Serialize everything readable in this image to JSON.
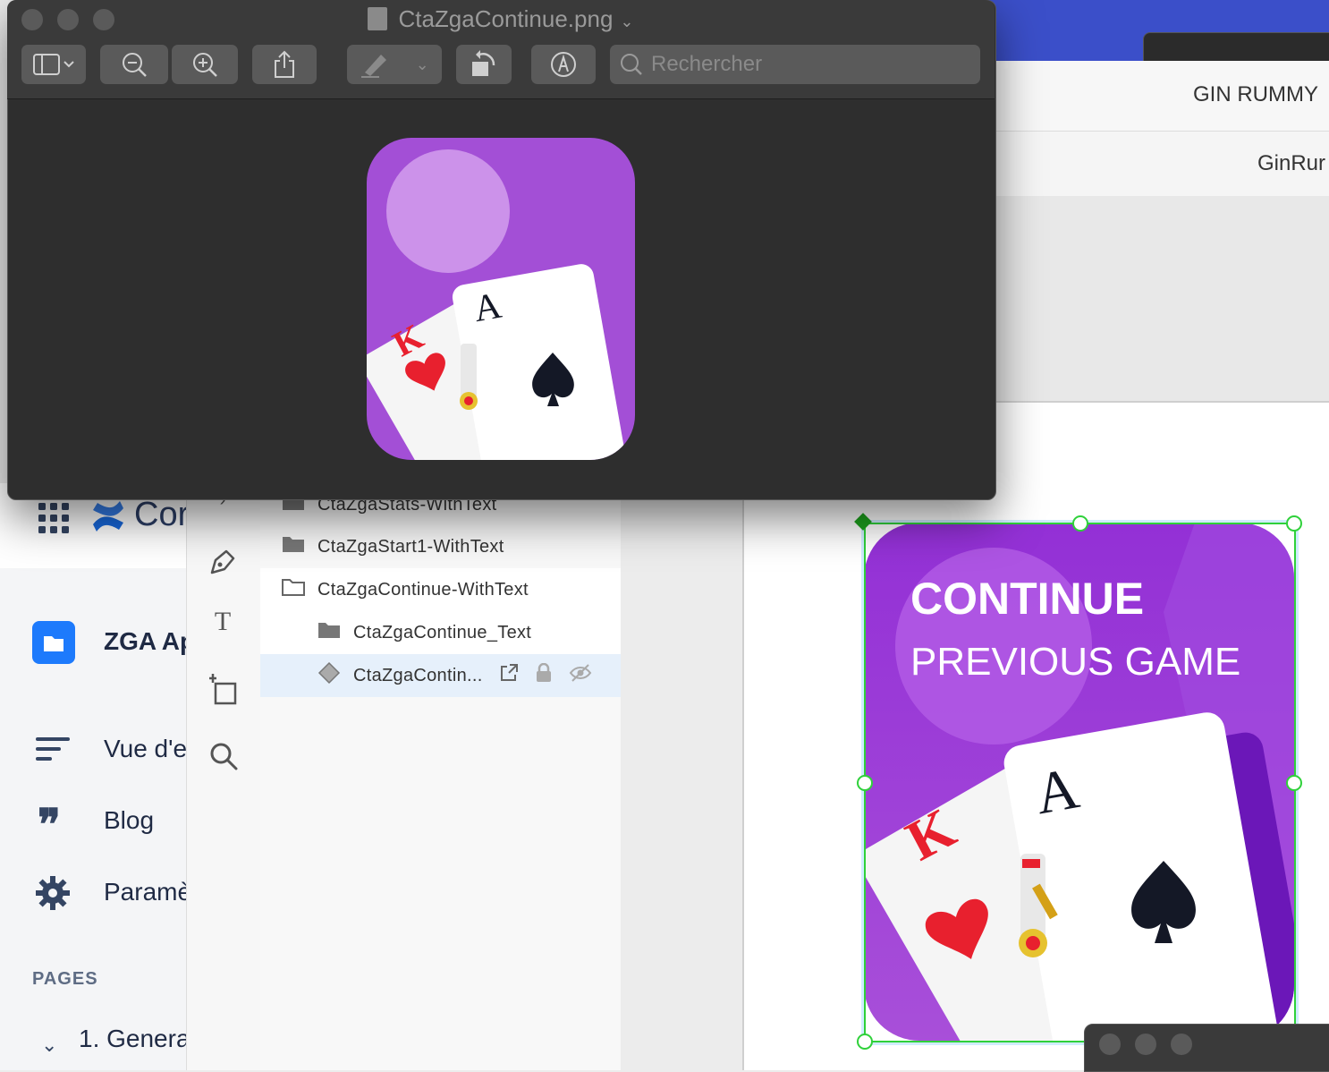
{
  "preview": {
    "title": "CtaZgaContinue.png",
    "search_placeholder": "Rechercher"
  },
  "ginrummy": {
    "header1": "GIN RUMMY",
    "header2": "GinRur"
  },
  "confluence": {
    "app_name_partial": "Cor",
    "space_name_partial": "ZGA Ap",
    "nav": {
      "overview": "Vue d'e",
      "blog": "Blog",
      "settings": "Paramè"
    },
    "pages_heading": "PAGES",
    "tree_item": "1. Genera"
  },
  "figma": {
    "layers": [
      {
        "name": "CtaZgaStats-WithText",
        "type": "folder"
      },
      {
        "name": "CtaZgaStart1-WithText",
        "type": "folder"
      },
      {
        "name": "CtaZgaContinue-WithText",
        "type": "folder-open"
      },
      {
        "name": "CtaZgaContinue_Text",
        "type": "folder"
      },
      {
        "name": "CtaZgaContin...",
        "type": "component"
      }
    ],
    "artwork": {
      "line1": "CONTINUE",
      "line2": "PREVIOUS GAME"
    }
  },
  "cards": {
    "king_rank": "K",
    "ace_rank": "A"
  },
  "colors": {
    "purple": "#9b3fd6",
    "purple_light": "#c88ae8",
    "selection_green": "#2fd13a",
    "heart_red": "#e8202e"
  }
}
